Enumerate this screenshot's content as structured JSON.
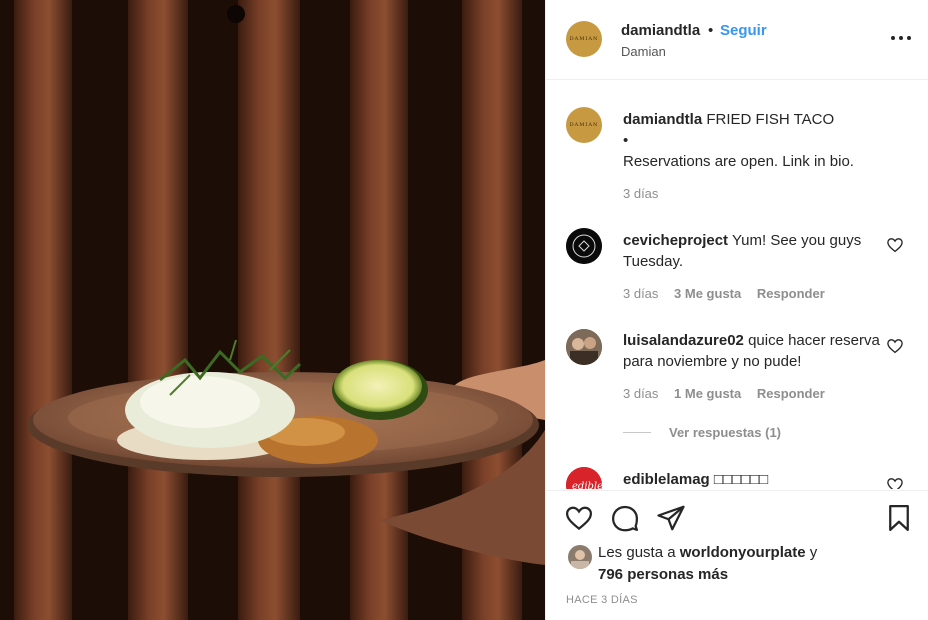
{
  "post": {
    "username": "damiandtla",
    "follow_label": "Seguir",
    "separator": "•",
    "location": "Damian",
    "avatar_text": "DAMIAN"
  },
  "caption": {
    "username": "damiandtla",
    "text": "FRIED FISH TACO",
    "bullet": "•",
    "line2": "Reservations are open. Link in bio.",
    "time": "3 días"
  },
  "comments": [
    {
      "username": "cevicheproject",
      "text": "Yum! See you guys Tuesday.",
      "time": "3 días",
      "likes": "3 Me gusta",
      "reply": "Responder"
    },
    {
      "username": "luisalandazure02",
      "text": "quice hacer reserva para noviembre y no pude!",
      "time": "3 días",
      "likes": "1 Me gusta",
      "reply": "Responder",
      "view_replies": "Ver respuestas (1)"
    },
    {
      "username": "ediblelamag",
      "text": "□□□□□□"
    }
  ],
  "likes": {
    "prefix": "Les gusta a",
    "user": "worldonyourplate",
    "suffix": "y",
    "others": "796 personas más"
  },
  "date": "HACE 3 DÍAS",
  "icons": [
    "more-icon",
    "heart-icon",
    "comment-icon",
    "share-icon",
    "bookmark-icon"
  ],
  "colors": {
    "link": "#3897f0",
    "text": "#262626",
    "muted": "#8e8e8e",
    "avatar": "#c79a42"
  }
}
